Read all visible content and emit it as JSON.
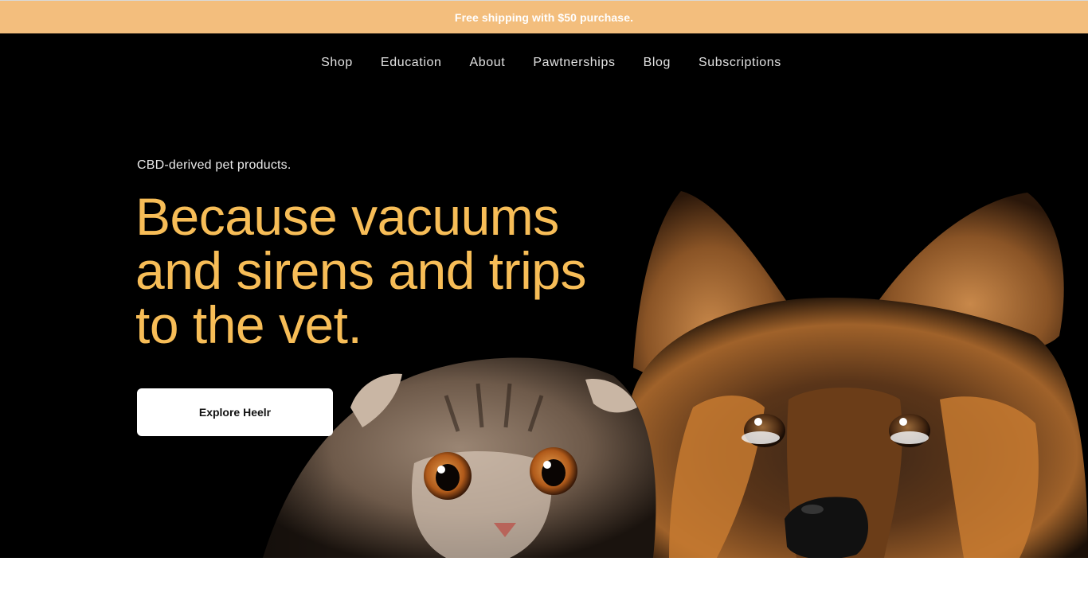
{
  "promo_bar": {
    "text": "Free shipping with $50 purchase."
  },
  "nav": {
    "items": [
      {
        "label": "Shop"
      },
      {
        "label": "Education"
      },
      {
        "label": "About"
      },
      {
        "label": "Pawtnerships"
      },
      {
        "label": "Blog"
      },
      {
        "label": "Subscriptions"
      }
    ]
  },
  "hero": {
    "eyebrow": "CBD-derived pet products.",
    "headline_lines": [
      "Because vacuums",
      "and sirens and trips",
      "to the vet."
    ],
    "cta_label": "Explore Heelr",
    "image": "kitten-and-dog-looking-up-photo"
  },
  "colors": {
    "promo_background": "#f3be7d",
    "hero_background": "#000000",
    "headline": "#f7bd57",
    "button_background": "#ffffff"
  }
}
